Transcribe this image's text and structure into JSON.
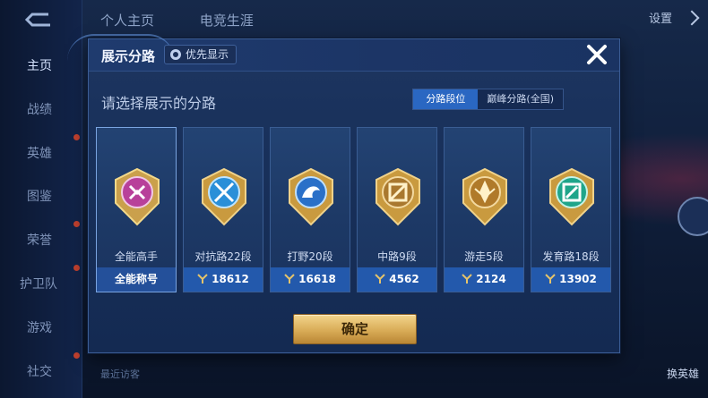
{
  "nav": {
    "items": [
      "主页",
      "战绩",
      "英雄",
      "图鉴",
      "荣誉",
      "护卫队",
      "游戏",
      "社交"
    ]
  },
  "top": {
    "tabs": [
      "个人主页",
      "电竞生涯"
    ],
    "settings_label": "设置"
  },
  "bottom": {
    "visitors_label": "最近访客",
    "switch_label": "换英雄"
  },
  "modal": {
    "title": "展示分路",
    "priority_label": "优先显示",
    "subtitle": "请选择展示的分路",
    "toggle": [
      "分路段位",
      "巅峰分路(全国)"
    ],
    "confirm_label": "确定",
    "cards": [
      {
        "name": "全能高手",
        "footer": "全能称号",
        "score": "",
        "badge": "allround-badge-icon",
        "selected": true,
        "color": "#b8409a"
      },
      {
        "name": "对抗路22段",
        "footer": "",
        "score": "18612",
        "badge": "clash-lane-badge-icon",
        "selected": false,
        "color": "#2a8fd8"
      },
      {
        "name": "打野20段",
        "footer": "",
        "score": "16618",
        "badge": "jungle-badge-icon",
        "selected": false,
        "color": "#2a70c8"
      },
      {
        "name": "中路9段",
        "footer": "",
        "score": "4562",
        "badge": "mid-lane-badge-icon",
        "selected": false,
        "color": "#a9782e"
      },
      {
        "name": "游走5段",
        "footer": "",
        "score": "2124",
        "badge": "roam-badge-icon",
        "selected": false,
        "color": "#b07a2a"
      },
      {
        "name": "发育路18段",
        "footer": "",
        "score": "13902",
        "badge": "farm-lane-badge-icon",
        "selected": false,
        "color": "#1fa58a"
      }
    ]
  }
}
